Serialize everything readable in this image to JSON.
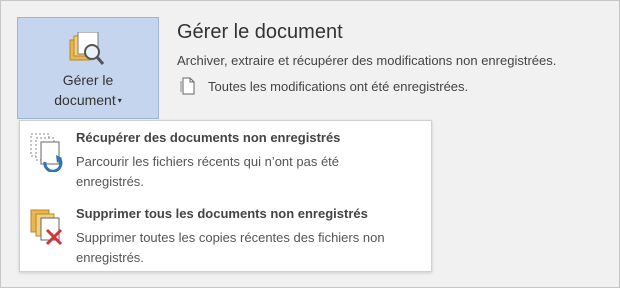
{
  "manage_button": {
    "line1": "Gérer le",
    "line2": "document",
    "caret": "▾",
    "icon": "folder-search-icon"
  },
  "section": {
    "title": "Gérer le document",
    "description": "Archiver, extraire et récupérer des modifications non enregistrées.",
    "status": "Toutes les modifications ont été enregistrées.",
    "status_icon": "document-icon"
  },
  "menu": {
    "items": [
      {
        "title": "Récupérer des documents non enregistrés",
        "description": "Parcourir les fichiers récents qui n’ont pas été enregistrés.",
        "icon": "recover-documents-icon"
      },
      {
        "title": "Supprimer tous les documents non enregistrés",
        "description": "Supprimer toutes les copies récentes des fichiers non enregistrés.",
        "icon": "delete-documents-icon"
      }
    ]
  },
  "colors": {
    "button_bg": "#c5d5ee",
    "accent_blue": "#2e75b6",
    "delete_red": "#d13438",
    "folder_yellow": "#e8b64c"
  }
}
